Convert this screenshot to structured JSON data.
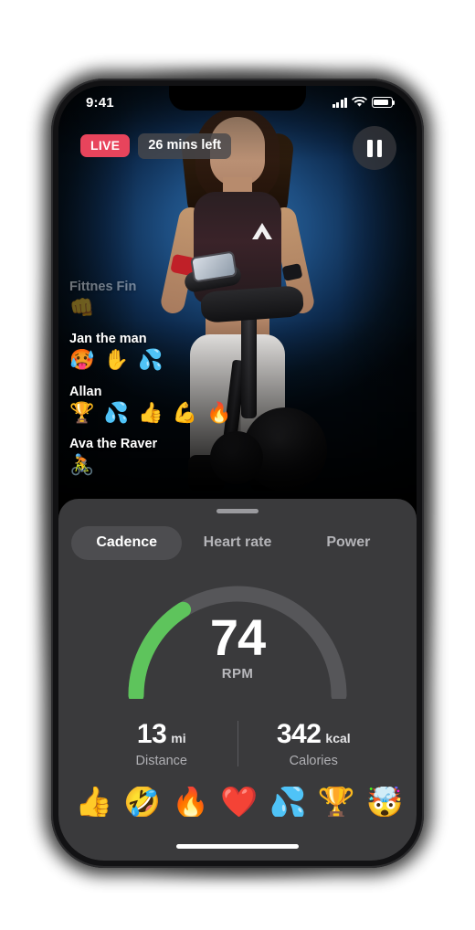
{
  "status_bar": {
    "time": "9:41",
    "signal_icon": "cellular-signal-icon",
    "wifi_icon": "wifi-icon",
    "battery_icon": "battery-icon"
  },
  "video": {
    "live_badge": "LIVE",
    "time_remaining": "26 mins left",
    "pause_icon": "pause-icon",
    "chat": [
      {
        "name": "Fittnes Fin",
        "emojis": "👊",
        "faded": true
      },
      {
        "name": "Jan the man",
        "emojis": "🥵 ✋ 💦",
        "faded": false
      },
      {
        "name": "Allan",
        "emojis": "🏆 💦 👍 💪 🔥",
        "faded": false
      },
      {
        "name": "Ava the Raver",
        "emojis": "🚴",
        "faded": false
      }
    ]
  },
  "panel": {
    "grabber": "drag-handle",
    "tabs": [
      {
        "label": "Cadence",
        "active": true
      },
      {
        "label": "Heart rate",
        "active": false
      },
      {
        "label": "Power",
        "active": false
      }
    ],
    "gauge": {
      "value": "74",
      "unit": "RPM",
      "fill_percent": 32,
      "arc_color": "#5ec45c",
      "track_color": "#565659"
    },
    "stats": [
      {
        "value": "13",
        "unit": "mi",
        "label": "Distance"
      },
      {
        "value": "342",
        "unit": "kcal",
        "label": "Calories"
      }
    ],
    "reactions": [
      {
        "emoji": "👍",
        "name": "thumbs-up"
      },
      {
        "emoji": "🤣",
        "name": "rofl"
      },
      {
        "emoji": "🔥",
        "name": "fire"
      },
      {
        "emoji": "❤️",
        "name": "heart"
      },
      {
        "emoji": "💦",
        "name": "sweat-droplets"
      },
      {
        "emoji": "🏆",
        "name": "trophy"
      },
      {
        "emoji": "🤯",
        "name": "exploding-head"
      }
    ]
  },
  "colors": {
    "live_red": "#e8445c",
    "panel_bg": "#3a3a3c",
    "accent_green": "#5ec45c"
  }
}
